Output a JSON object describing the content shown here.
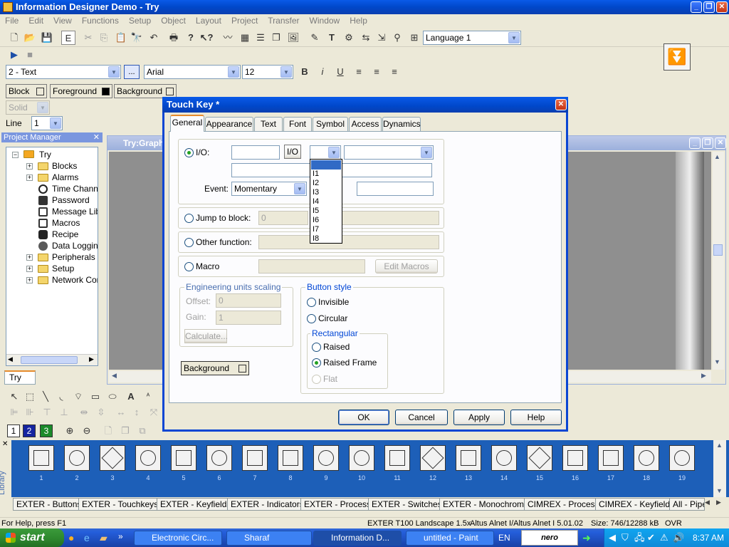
{
  "app": {
    "title": "Information Designer Demo - Try",
    "menu": [
      "File",
      "Edit",
      "View",
      "Functions",
      "Setup",
      "Object",
      "Layout",
      "Project",
      "Transfer",
      "Window",
      "Help"
    ],
    "language_select": "Language 1"
  },
  "format_bar": {
    "style_select": "2 - Text",
    "ellipsis": "...",
    "font_select": "Arial",
    "size_select": "12",
    "bold": "B",
    "italic": "i",
    "underline": "U"
  },
  "color_bar": {
    "block": "Block",
    "foreground": "Foreground",
    "background": "Background",
    "fill_select": "Solid",
    "line_label": "Line",
    "line_value": "1"
  },
  "project_manager": {
    "title": "Project Manager",
    "root": "Try",
    "items": [
      "Blocks",
      "Alarms",
      "Time Channe",
      "Password",
      "Message Libr",
      "Macros",
      "Recipe",
      "Data Logging",
      "Peripherals",
      "Setup",
      "Network Con"
    ],
    "tab": "Try"
  },
  "graphic_window": {
    "title": "Try:Graph"
  },
  "dialog": {
    "title": "Touch Key *",
    "tabs": [
      "General",
      "Appearance",
      "Text",
      "Font",
      "Symbol",
      "Access",
      "Dynamics"
    ],
    "io_label": "I/O:",
    "io_button": "I/O",
    "event_label": "Event:",
    "event_value": "Momentary",
    "io_options": [
      "",
      "I1",
      "I2",
      "I3",
      "I4",
      "I5",
      "I6",
      "I7",
      "I8"
    ],
    "jump_label": "Jump to block:",
    "jump_value": "0",
    "other_label": "Other function:",
    "macro_label": "Macro",
    "edit_macros": "Edit Macros",
    "eng_group": "Engineering units scaling",
    "offset_label": "Offset:",
    "offset_value": "0",
    "gain_label": "Gain:",
    "gain_value": "1",
    "calculate": "Calculate...",
    "background_btn": "Background",
    "button_style_group": "Button style",
    "invisible": "Invisible",
    "circular": "Circular",
    "rect_group": "Rectangular",
    "raised": "Raised",
    "raised_frame": "Raised Frame",
    "flat": "Flat",
    "ok": "OK",
    "cancel": "Cancel",
    "apply": "Apply",
    "help": "Help"
  },
  "library": {
    "side_label": "Library",
    "numbers": [
      "1",
      "2",
      "3",
      "4",
      "5",
      "6",
      "7",
      "8",
      "9",
      "10",
      "11",
      "12",
      "13",
      "14",
      "15",
      "16",
      "17",
      "18",
      "19"
    ],
    "tabs": [
      "EXTER - Buttons",
      "EXTER - Touchkeys",
      "EXTER - Keyfields",
      "EXTER - Indicators",
      "EXTER - Process",
      "EXTER - Switches",
      "EXTER - Monochrome",
      "CIMREX - Process",
      "CIMREX - Keyfields",
      "All - Pipe"
    ]
  },
  "statusbar": {
    "help": "For Help, press F1",
    "terminal": "EXTER T100 Landscape 1.5x",
    "driver": "Altus Alnet I/Altus Alnet I 5.01.02",
    "size": "Size: 746/12288 kB",
    "mode": "OVR"
  },
  "taskbar": {
    "start": "start",
    "tasks": [
      "Electronic Circ...",
      "Sharaf",
      "Information D...",
      "untitled - Paint"
    ],
    "lang": "EN",
    "nero": "nero",
    "clock": "8:37 AM"
  },
  "colors": {
    "xp_blue": "#0a46d3",
    "library_bg": "#1d5fb8",
    "tab_accent": "#e68b2c",
    "selection": "#316ac5"
  }
}
